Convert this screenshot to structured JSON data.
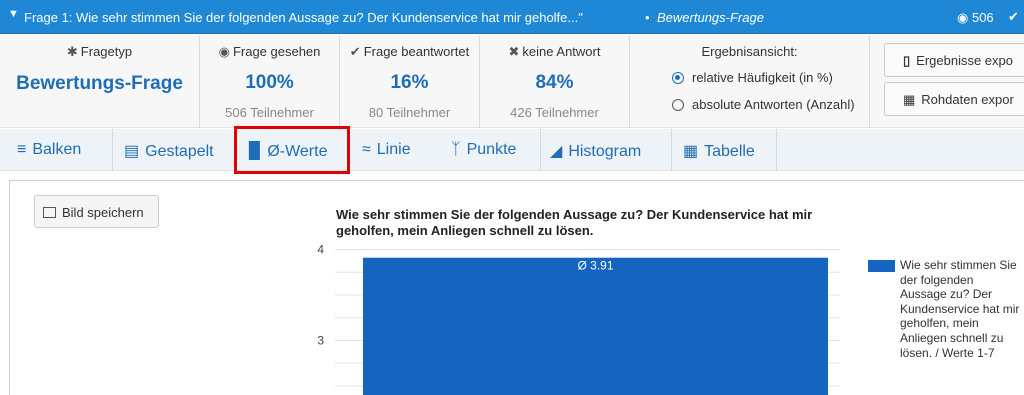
{
  "header": {
    "title": "Frage 1: Wie sehr stimmen Sie der folgenden Aussage zu? Der Kundenservice hat mir geholfe...\"",
    "separator": "•",
    "question_type": "Bewertungs-Frage",
    "views": "506",
    "icons": [
      "chevron-down-icon",
      "eye-icon",
      "check-icon"
    ]
  },
  "stats": {
    "fragetyp": {
      "label": "Fragetyp",
      "value": "Bewertungs-Frage",
      "icon": "gear-icon"
    },
    "gesehen": {
      "label": "Frage gesehen",
      "value": "100%",
      "sub": "506 Teilnehmer",
      "icon": "eye-icon"
    },
    "beantwortet": {
      "label": "Frage beantwortet",
      "value": "16%",
      "sub": "80 Teilnehmer",
      "icon": "check-icon"
    },
    "keine": {
      "label": "keine Antwort",
      "value": "84%",
      "sub": "426 Teilnehmer",
      "icon": "x-icon"
    }
  },
  "ergebnisansicht": {
    "label": "Ergebnisansicht:",
    "options": [
      {
        "label": "relative Häufigkeit (in %)",
        "selected": true
      },
      {
        "label": "absolute Antworten (Anzahl)",
        "selected": false
      }
    ]
  },
  "actions": {
    "export_results": "Ergebnisse expo",
    "export_raw": "Rohdaten expor"
  },
  "tabs": [
    {
      "label": "Balken",
      "icon": "bars-icon",
      "active": false
    },
    {
      "label": "Gestapelt",
      "icon": "stacked-icon",
      "active": false
    },
    {
      "label": "Ø-Werte",
      "icon": "bar-chart-icon",
      "active": true
    },
    {
      "label": "Linie",
      "icon": "line-chart-icon",
      "active": false
    },
    {
      "label": "Punkte",
      "icon": "points-icon",
      "active": false
    },
    {
      "label": "Histogram",
      "icon": "area-chart-icon",
      "active": false
    },
    {
      "label": "Tabelle",
      "icon": "table-icon",
      "active": false
    }
  ],
  "panel": {
    "save_button": "Bild speichern"
  },
  "chart_data": {
    "type": "bar",
    "title": "Wie sehr stimmen Sie der folgenden Aussage zu? Der Kundenservice hat mir geholfen, mein Anliegen schnell zu lösen.",
    "categories": [
      ""
    ],
    "series": [
      {
        "name": "Wie sehr stimmen Sie der folgenden Aussage zu? Der Kundenservice hat mir geholfen, mein Anliegen schnell zu lösen. / Werte 1-7",
        "values": [
          3.91
        ]
      }
    ],
    "data_label": "Ø 3.91",
    "yticks": [
      "4",
      "3"
    ],
    "ylim_visible": [
      2.4,
      4.05
    ],
    "bar_color": "#1565c0",
    "grid": true,
    "legend": "right"
  }
}
